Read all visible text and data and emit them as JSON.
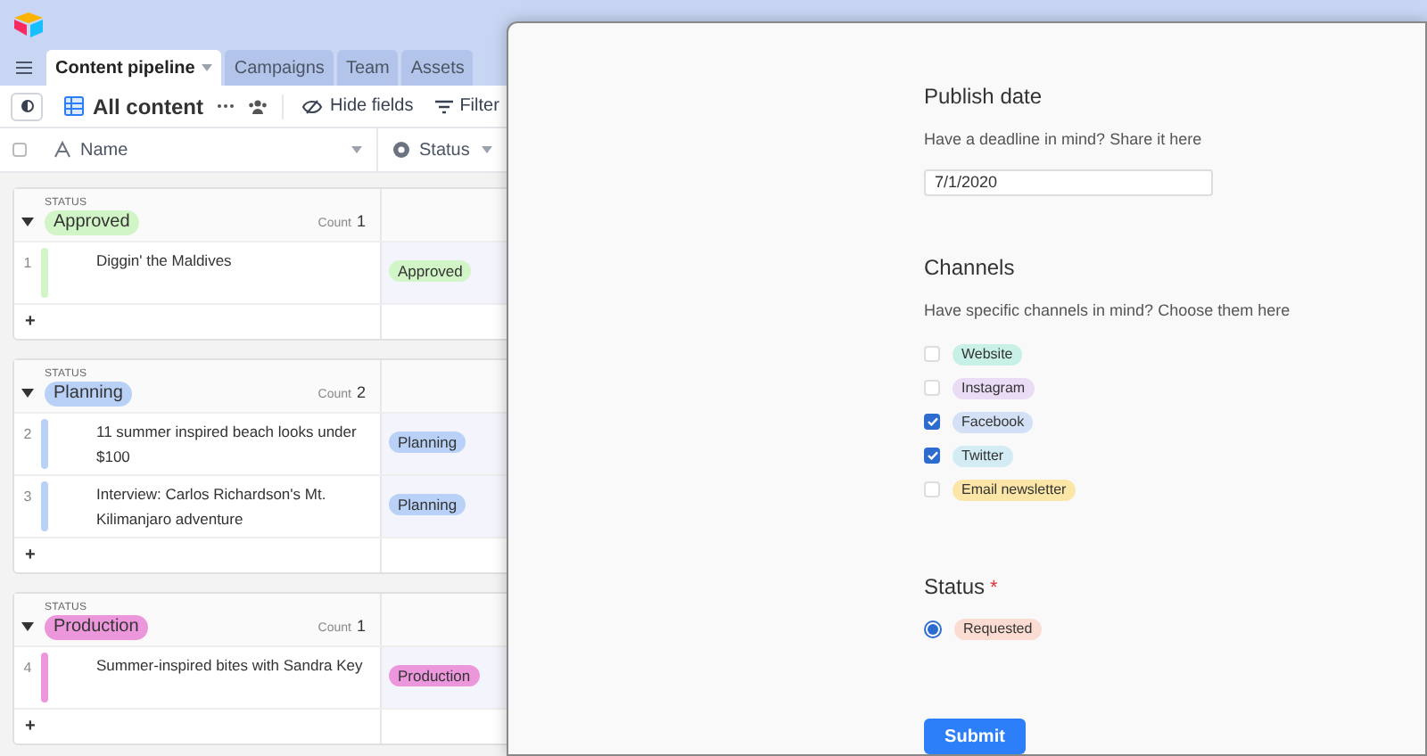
{
  "tabs": [
    {
      "label": "Content pipeline",
      "selected": true,
      "caret": true
    },
    {
      "label": "Campaigns",
      "selected": false,
      "caret": false
    },
    {
      "label": "Team",
      "selected": false,
      "caret": false
    },
    {
      "label": "Assets",
      "selected": false,
      "caret": false
    }
  ],
  "view": {
    "name": "All content",
    "actions": [
      {
        "kind": "hide",
        "label": "Hide fields"
      },
      {
        "kind": "filter",
        "label": "Filter"
      }
    ]
  },
  "select_all": {
    "checked": false
  },
  "columns": [
    {
      "kind": "text",
      "label": "Name"
    },
    {
      "kind": "status",
      "label": "Status"
    }
  ],
  "groups": [
    {
      "field": "STATUS",
      "value": "Approved",
      "color": "#d1f5c6",
      "count_label": "Count",
      "count": "1",
      "expanded": true,
      "add": "+",
      "rows": [
        {
          "number": "1",
          "name": "Diggin' the Maldives",
          "status": "Approved"
        }
      ]
    },
    {
      "field": "STATUS",
      "value": "Planning",
      "color": "#b9d1f7",
      "count_label": "Count",
      "count": "2",
      "expanded": true,
      "add": "+",
      "rows": [
        {
          "number": "2",
          "name": "11 summer inspired beach looks under $100",
          "status": "Planning"
        },
        {
          "number": "3",
          "name": "Interview: Carlos Richardson's Mt. Kilimanjaro adventure",
          "status": "Planning"
        }
      ]
    },
    {
      "field": "STATUS",
      "value": "Production",
      "color": "#ec97dc",
      "count_label": "Count",
      "count": "1",
      "expanded": true,
      "add": "+",
      "rows": [
        {
          "number": "4",
          "name": "Summer-inspired bites with Sandra Key",
          "status": "Production"
        }
      ]
    }
  ],
  "form": {
    "publish_date": {
      "title": "Publish date",
      "description": "Have a deadline in mind? Share it here",
      "value": "7/1/2020"
    },
    "channels": {
      "title": "Channels",
      "description": "Have specific channels in mind? Choose them here",
      "options": [
        {
          "label": "Website",
          "color": "#c8f0e6",
          "checked": false
        },
        {
          "label": "Instagram",
          "color": "#eadcf5",
          "checked": false
        },
        {
          "label": "Facebook",
          "color": "#d4e0f5",
          "checked": true
        },
        {
          "label": "Twitter",
          "color": "#d3ecf4",
          "checked": true
        },
        {
          "label": "Email newsletter",
          "color": "#fbe6a8",
          "checked": false
        }
      ]
    },
    "status": {
      "title": "Status",
      "required": true,
      "required_mark": "*",
      "options": [
        {
          "label": "Requested",
          "color": "#fadcd2",
          "selected": true
        }
      ]
    },
    "submit": "Submit"
  }
}
